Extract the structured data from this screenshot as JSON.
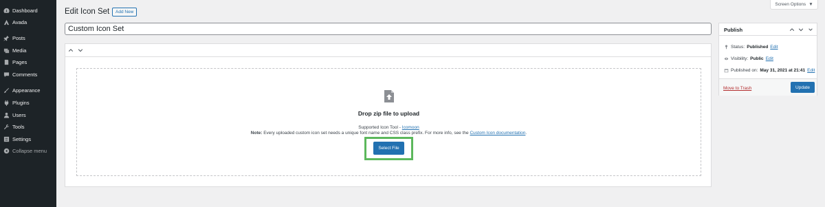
{
  "sidebar": {
    "items": [
      {
        "label": "Dashboard",
        "icon": "dashboard-icon"
      },
      {
        "label": "Avada",
        "icon": "avada-icon"
      },
      {
        "label": "Posts",
        "icon": "pin-icon"
      },
      {
        "label": "Media",
        "icon": "media-icon"
      },
      {
        "label": "Pages",
        "icon": "pages-icon"
      },
      {
        "label": "Comments",
        "icon": "comment-icon"
      },
      {
        "label": "Appearance",
        "icon": "brush-icon"
      },
      {
        "label": "Plugins",
        "icon": "plugin-icon"
      },
      {
        "label": "Users",
        "icon": "users-icon"
      },
      {
        "label": "Tools",
        "icon": "wrench-icon"
      },
      {
        "label": "Settings",
        "icon": "settings-icon"
      },
      {
        "label": "Collapse menu",
        "icon": "collapse-icon"
      }
    ]
  },
  "header": {
    "title": "Edit Icon Set",
    "add_new": "Add New",
    "screen_options": "Screen Options"
  },
  "title_input": {
    "value": "Custom Icon Set"
  },
  "upload": {
    "drop_title": "Drop zip file to upload",
    "supported_prefix": "Supported Icon Tool - ",
    "supported_link": "Icomoon",
    "note_label": "Note:",
    "note_text": " Every uploaded custom icon set needs a unique font name and CSS class prefix. For more info, see the ",
    "note_link": "Custom Icon documentation",
    "note_end": ".",
    "select_file": "Select File",
    "highlight_color": "#5cb85c"
  },
  "publish": {
    "title": "Publish",
    "status_label": "Status:",
    "status_value": "Published",
    "visibility_label": "Visibility:",
    "visibility_value": "Public",
    "published_label": "Published on:",
    "published_value": "May 31, 2021 at 21:41",
    "edit": "Edit",
    "move_to_trash": "Move to Trash",
    "update": "Update"
  },
  "colors": {
    "sidebar_bg": "#1d2327",
    "accent": "#2271b1",
    "page_bg": "#f0f0f1"
  }
}
